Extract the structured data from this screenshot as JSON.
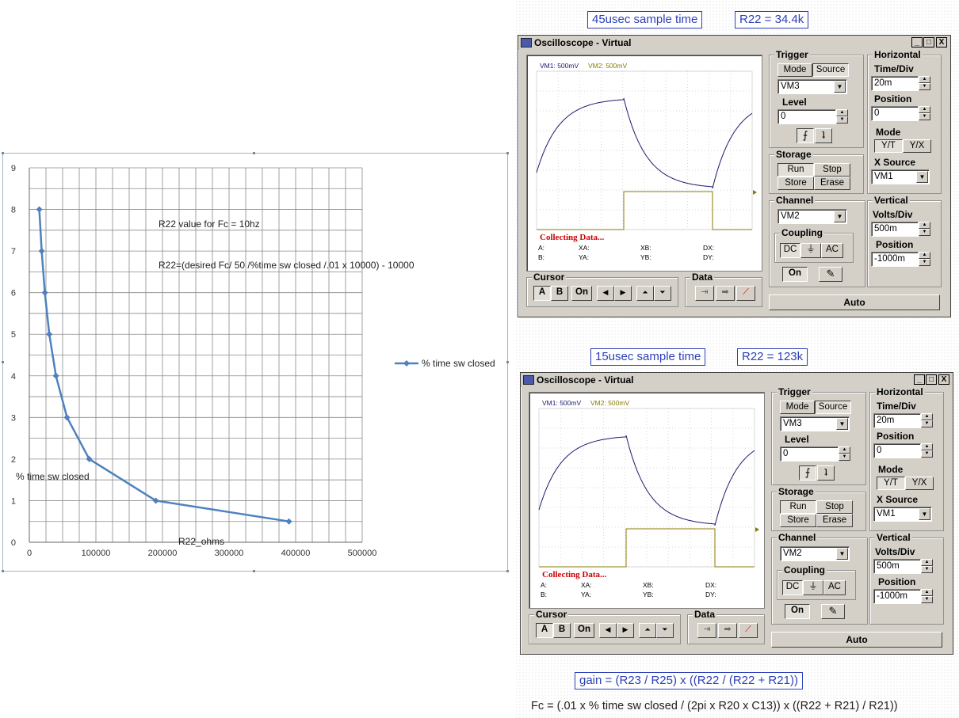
{
  "captions": {
    "top_sample": "45usec sample time",
    "top_r22": "R22 = 34.4k",
    "bottom_sample": "15usec sample time",
    "bottom_r22": "R22 = 123k",
    "gain": "gain = (R23 / R25) x ((R22 / (R22 + R21))",
    "fc_formula": "Fc = (.01 x % time sw closed / (2pi x R20 x C13)) x ((R22 + R21) / R21))"
  },
  "chart_data": {
    "type": "line",
    "title": "",
    "annotations": [
      "R22 value for Fc = 10hz",
      "R22=(desired Fc/ 50  /%time sw closed  /.01 x 10000)  - 10000"
    ],
    "xlabel": "R22_ohms",
    "ylabel": "% time sw closed",
    "xlim": [
      0,
      500000
    ],
    "ylim": [
      0,
      9
    ],
    "xticks": [
      "0",
      "100000",
      "200000",
      "300000",
      "400000",
      "500000"
    ],
    "yticks": [
      "0",
      "1",
      "2",
      "3",
      "4",
      "5",
      "6",
      "7",
      "8",
      "9"
    ],
    "grid": true,
    "legend_position": "right",
    "series": [
      {
        "name": "% time sw closed",
        "color": "#4f81bd",
        "x": [
          15000,
          18571,
          23333,
          30000,
          40000,
          56667,
          90000,
          190000,
          390000
        ],
        "y": [
          8,
          7,
          6,
          5,
          4,
          3,
          2,
          1,
          0.5
        ]
      }
    ]
  },
  "oscilloscope": {
    "title": "Oscilloscope - Virtual",
    "win_buttons": [
      "_",
      "□",
      "X"
    ],
    "vm1_label": "VM1: 500mV",
    "vm2_label": "VM2: 500mV",
    "collecting": "Collecting Data...",
    "readouts": [
      "A:",
      "XA:",
      "XB:",
      "DX:",
      "B:",
      "YA:",
      "YB:",
      "DY:"
    ],
    "trigger": {
      "title": "Trigger",
      "mode": "Mode",
      "source": "Source",
      "source_value": "VM3",
      "level_label": "Level",
      "level_value": "0"
    },
    "horizontal": {
      "title": "Horizontal",
      "timediv_label": "Time/Div",
      "timediv_value": "20m",
      "position_label": "Position",
      "position_value": "0",
      "mode_label": "Mode",
      "yt": "Y/T",
      "yx": "Y/X",
      "xsource_label": "X Source",
      "xsource_value": "VM1"
    },
    "storage": {
      "title": "Storage",
      "run": "Run",
      "stop": "Stop",
      "store": "Store",
      "erase": "Erase"
    },
    "channel": {
      "title": "Channel",
      "value": "VM2",
      "coupling": "Coupling",
      "dc": "DC",
      "gnd": "⏚",
      "ac": "AC",
      "on": "On"
    },
    "vertical": {
      "title": "Vertical",
      "voltsdiv_label": "Volts/Div",
      "voltsdiv_value": "500m",
      "position_label": "Position",
      "position_value": "-1000m"
    },
    "cursor": {
      "title": "Cursor",
      "a": "A",
      "b": "B",
      "on": "On"
    },
    "data": {
      "title": "Data"
    },
    "auto": "Auto"
  },
  "colors": {
    "caption_blue": "#2b3fb8",
    "trace_vm1": "#1a1a6e",
    "trace_vm2": "#8a7a00",
    "collecting": "#cc0000"
  }
}
